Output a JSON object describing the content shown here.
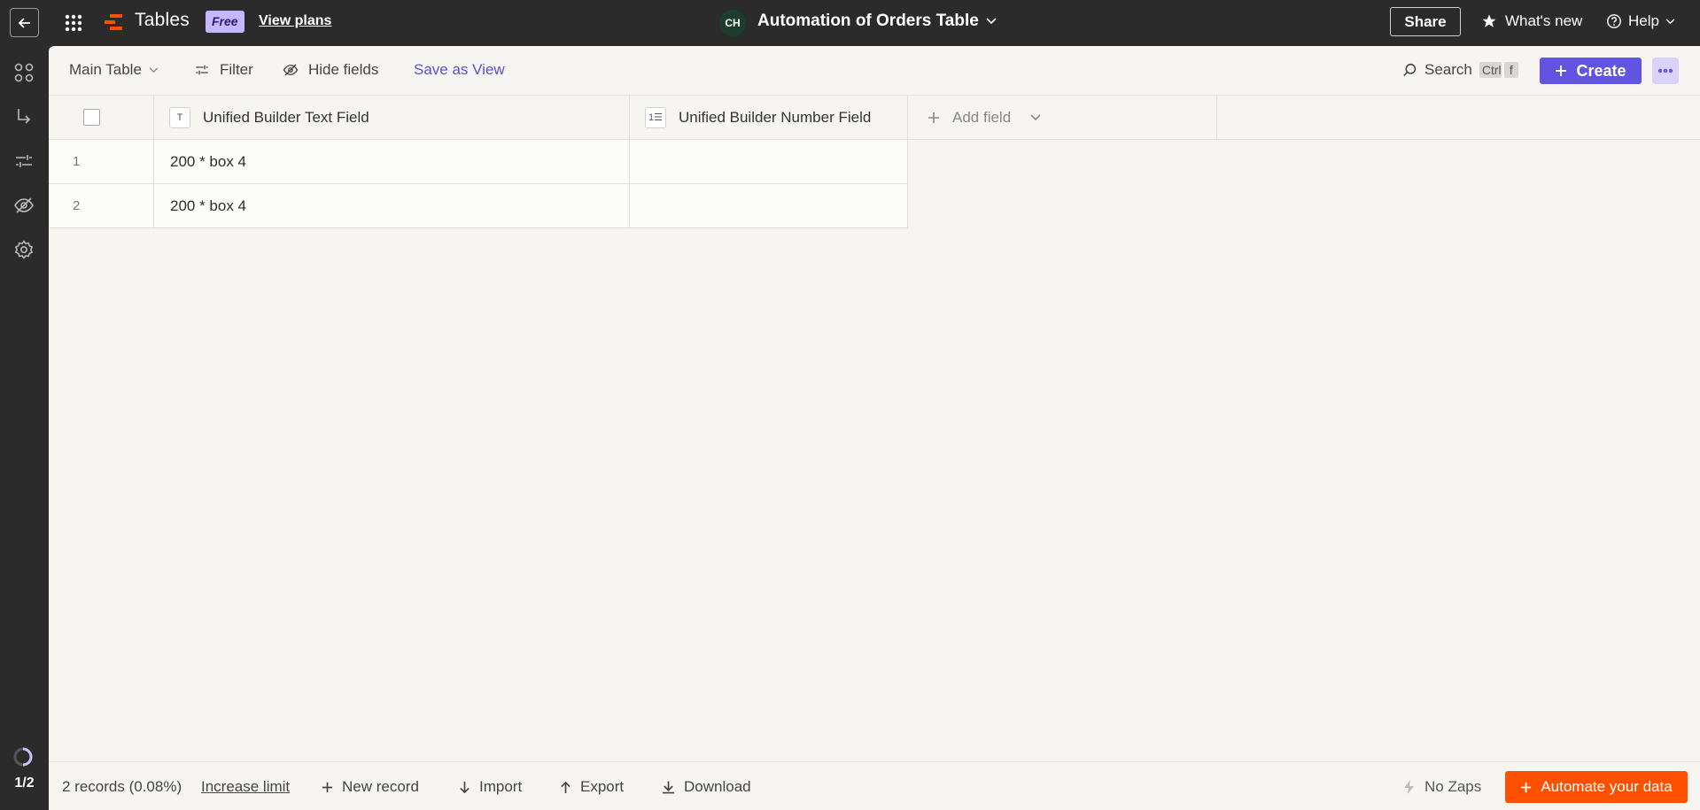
{
  "topbar": {
    "app_name": "Tables",
    "plan_badge": "Free",
    "view_plans": "View plans",
    "avatar_initials": "CH",
    "table_title": "Automation of Orders Table",
    "share": "Share",
    "whats_new": "What's new",
    "help": "Help"
  },
  "rail": {
    "page_indicator": "1/2"
  },
  "toolbar": {
    "view_selector": "Main Table",
    "filter": "Filter",
    "hide_fields": "Hide fields",
    "save_as_view": "Save as View",
    "search": "Search",
    "search_shortcut_1": "Ctrl",
    "search_shortcut_2": "f",
    "create": "Create"
  },
  "table": {
    "columns": [
      {
        "label": "Unified Builder Text Field",
        "type_icon": "T"
      },
      {
        "label": "Unified Builder Number Field",
        "type_icon": "1☰"
      }
    ],
    "add_field": "Add field",
    "rows": [
      {
        "num": "1",
        "text": "200 * box 4",
        "number": ""
      },
      {
        "num": "2",
        "text": "200 * box 4",
        "number": ""
      }
    ]
  },
  "footer": {
    "records": "2 records (0.08%)",
    "increase_limit": "Increase limit",
    "new_record": "New record",
    "import": "Import",
    "export": "Export",
    "download": "Download",
    "no_zaps": "No Zaps",
    "automate": "Automate your data"
  },
  "colors": {
    "accent": "#6154e0",
    "brand_orange": "#ff4f00",
    "topbar": "#2b2b2b",
    "canvas": "#f6f5f2"
  }
}
